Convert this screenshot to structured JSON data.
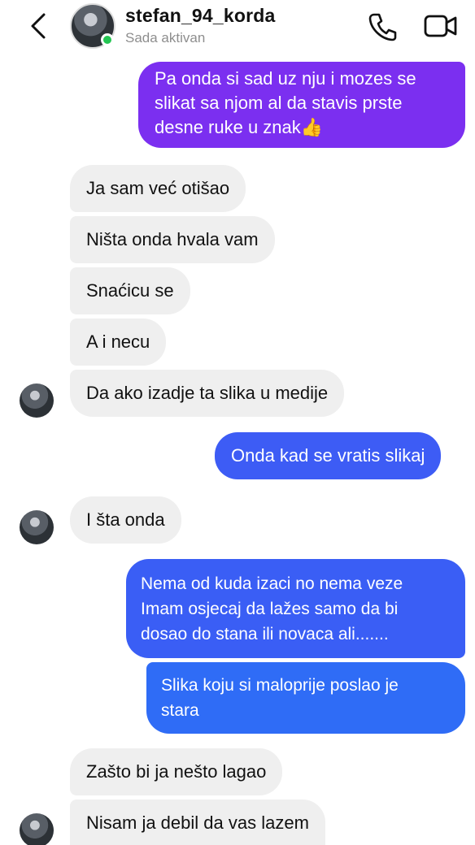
{
  "header": {
    "username": "stefan_94_korda",
    "status": "Sada aktivan",
    "icons": [
      "back-icon",
      "phone-icon",
      "video-camera-icon"
    ]
  },
  "colors": {
    "outgoing_purple": "#7b2ff0",
    "outgoing_blue": "#3d5cf5",
    "outgoing_blue_light": "#2f6cf6",
    "incoming": "#efefef",
    "online": "#23c552"
  },
  "messages": [
    {
      "side": "out",
      "text": "Pa onda si sad uz nju i mozes se\nslikat sa njom al da stavis prste\ndesne ruke u znak👍"
    },
    {
      "side": "in",
      "text": "Ja sam već otišao"
    },
    {
      "side": "in",
      "text": "Ništa onda hvala vam"
    },
    {
      "side": "in",
      "text": "Snaćicu se"
    },
    {
      "side": "in",
      "text": "A i necu"
    },
    {
      "side": "in",
      "text": "Da ako izadje ta slika u medije"
    },
    {
      "side": "out",
      "text": "Onda kad se vratis slikaj"
    },
    {
      "side": "in",
      "text": "I šta onda"
    },
    {
      "side": "out",
      "text": "Nema od kuda izaci no nema veze\nImam osjecaj da lažes samo da bi\ndosao do stana ili novaca ali......."
    },
    {
      "side": "out",
      "text": "Slika koju si maloprije poslao je\nstara"
    },
    {
      "side": "in",
      "text": "Zašto bi ja nešto lagao"
    },
    {
      "side": "in",
      "text": "Nisam ja debil da vas lazem"
    }
  ]
}
